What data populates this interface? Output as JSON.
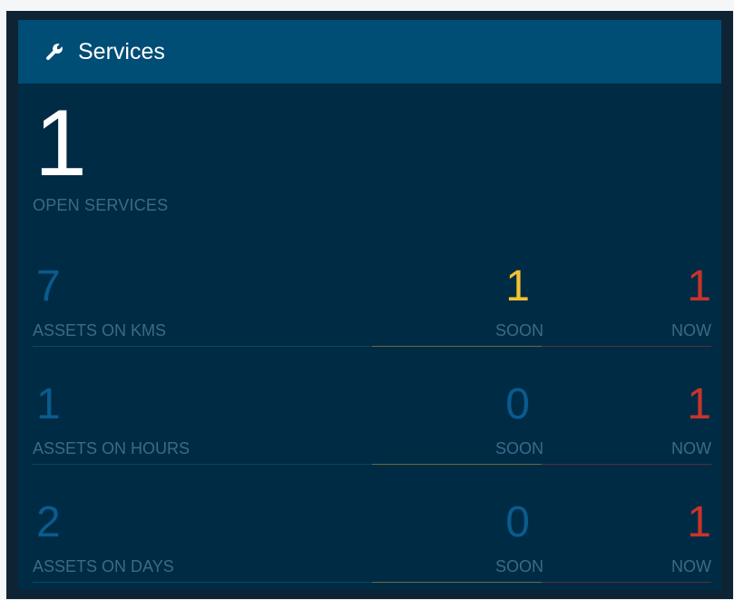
{
  "header": {
    "title": "Services",
    "icon": "wrench-icon"
  },
  "summary": {
    "count": "1",
    "label": "OPEN SERVICES"
  },
  "colors": {
    "soon_warning": "#f2c232",
    "soon_ok": "#0a5b8e",
    "now": "#c8342b",
    "main": "#0a5b8e"
  },
  "rows": [
    {
      "count": "7",
      "label": "ASSETS ON KMS",
      "soon": "1",
      "soon_label": "SOON",
      "now": "1",
      "now_label": "NOW"
    },
    {
      "count": "1",
      "label": "ASSETS ON HOURS",
      "soon": "0",
      "soon_label": "SOON",
      "now": "1",
      "now_label": "NOW"
    },
    {
      "count": "2",
      "label": "ASSETS ON DAYS",
      "soon": "0",
      "soon_label": "SOON",
      "now": "1",
      "now_label": "NOW"
    }
  ]
}
